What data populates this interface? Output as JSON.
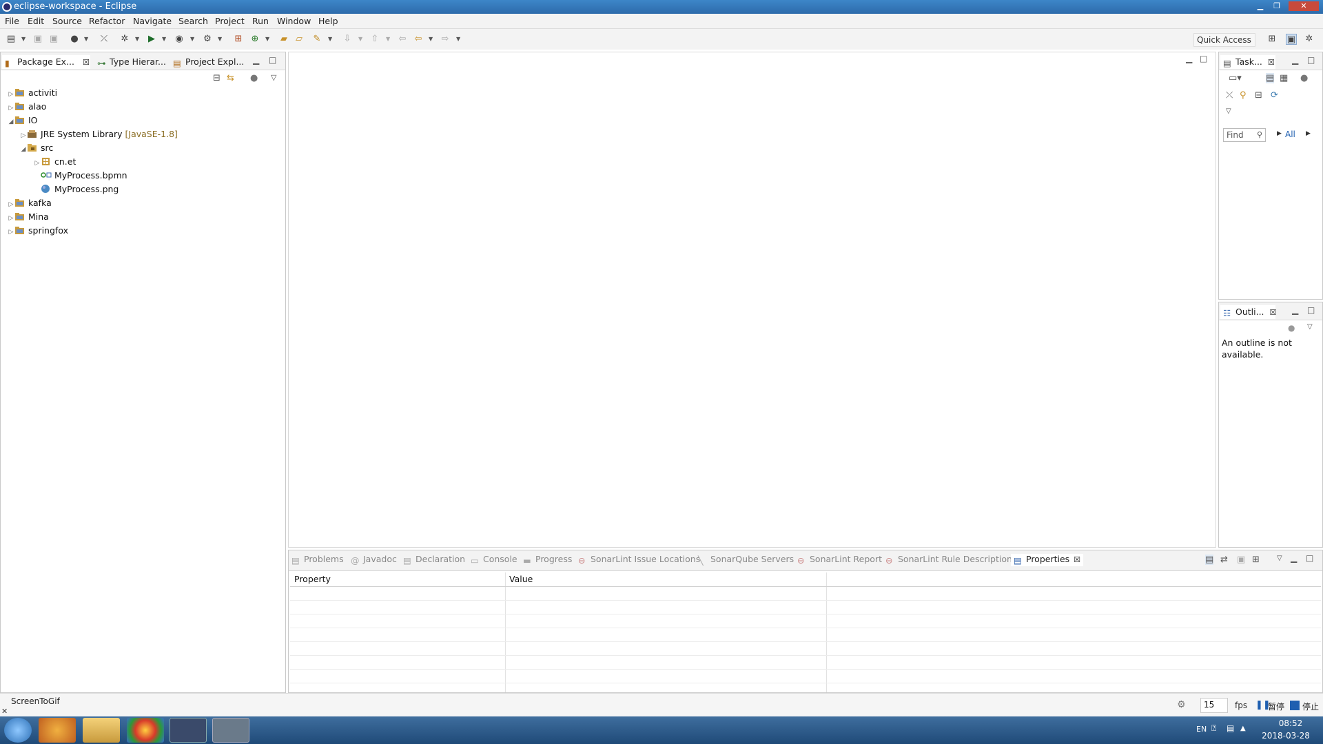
{
  "window": {
    "title": "eclipse-workspace - Eclipse"
  },
  "menu": [
    "File",
    "Edit",
    "Source",
    "Refactor",
    "Navigate",
    "Search",
    "Project",
    "Run",
    "Window",
    "Help"
  ],
  "quick_access": "Quick Access",
  "left_tabs": [
    {
      "label": "Package Ex...",
      "close": "☒"
    },
    {
      "label": "Type Hierar..."
    },
    {
      "label": "Project Expl..."
    }
  ],
  "tree": [
    {
      "label": "activiti",
      "indent": 0,
      "twisty": "▷"
    },
    {
      "label": "alao",
      "indent": 0,
      "twisty": "▷"
    },
    {
      "label": "IO",
      "indent": 0,
      "twisty": "◢"
    },
    {
      "label": "JRE System Library",
      "extra": "[JavaSE-1.8]",
      "indent": 1,
      "twisty": "▷"
    },
    {
      "label": "src",
      "indent": 1,
      "twisty": "◢"
    },
    {
      "label": "cn.et",
      "indent": 2,
      "twisty": "▷"
    },
    {
      "label": "MyProcess.bpmn",
      "indent": 2,
      "twisty": ""
    },
    {
      "label": "MyProcess.png",
      "indent": 2,
      "twisty": ""
    },
    {
      "label": "kafka",
      "indent": 0,
      "twisty": "▷"
    },
    {
      "label": "Mina",
      "indent": 0,
      "twisty": "▷"
    },
    {
      "label": "springfox",
      "indent": 0,
      "twisty": "▷"
    }
  ],
  "right_top": {
    "tab": "Task...",
    "find_placeholder": "Find",
    "all": "All"
  },
  "outline": {
    "tab": "Outli...",
    "message_1": "An outline is not",
    "message_2": "available."
  },
  "bottom_tabs": [
    "Problems",
    "Javadoc",
    "Declaration",
    "Console",
    "Progress",
    "SonarLint Issue Locations",
    "SonarQube Servers",
    "SonarLint Report",
    "SonarLint Rule Description",
    "Properties"
  ],
  "properties": {
    "col_property": "Property",
    "col_value": "Value"
  },
  "screentogif": {
    "label": "ScreenToGif",
    "fps_value": "15",
    "fps_label": "fps",
    "pause": "暂停",
    "stop": "停止"
  },
  "taskbar": {
    "lang": "EN",
    "time": "08:52",
    "date": "2018-03-28"
  }
}
